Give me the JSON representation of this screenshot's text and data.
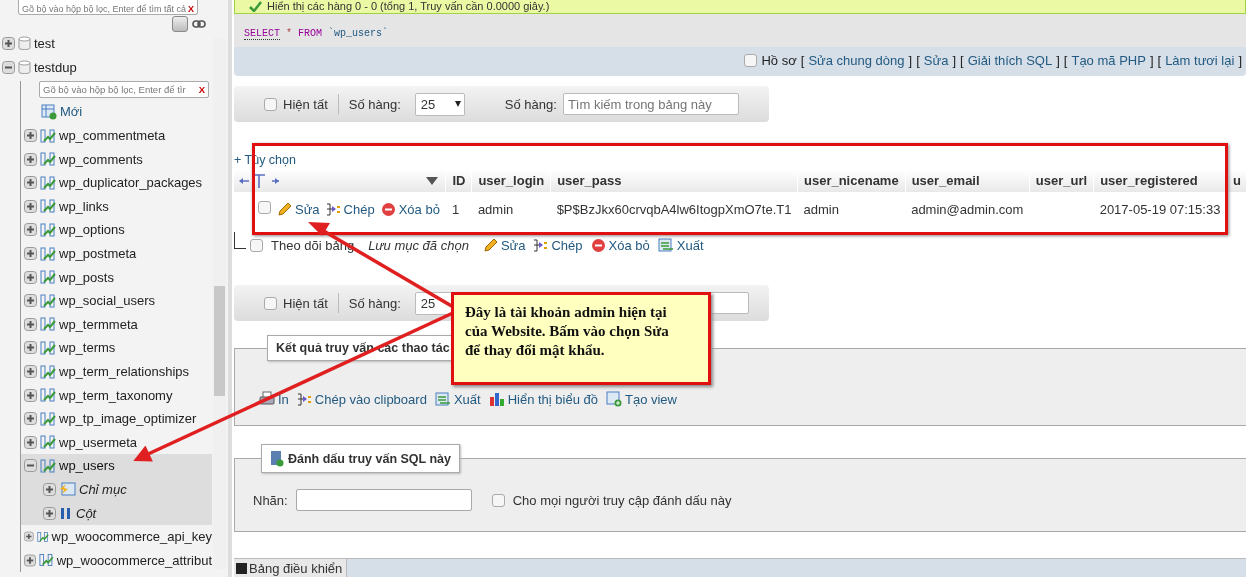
{
  "sidebar": {
    "filter_placeholder": "Gõ bộ vào hộp bộ lọc, Enter để tìm tất cả",
    "clear_label": "X",
    "databases": [
      {
        "name": "test",
        "expanded": false
      },
      {
        "name": "testdup",
        "expanded": true,
        "filter_placeholder": "Gõ bộ vào hộp bộ lọc, Enter để tìr",
        "clear_label": "X",
        "new_label": "Mới",
        "children": [
          {
            "name": "wp_commentmeta",
            "expanded": false,
            "selected": false
          },
          {
            "name": "wp_comments",
            "expanded": false,
            "selected": false
          },
          {
            "name": "wp_duplicator_packages",
            "expanded": false,
            "selected": false
          },
          {
            "name": "wp_links",
            "expanded": false,
            "selected": false
          },
          {
            "name": "wp_options",
            "expanded": false,
            "selected": false
          },
          {
            "name": "wp_postmeta",
            "expanded": false,
            "selected": false
          },
          {
            "name": "wp_posts",
            "expanded": false,
            "selected": false
          },
          {
            "name": "wp_social_users",
            "expanded": false,
            "selected": false
          },
          {
            "name": "wp_termmeta",
            "expanded": false,
            "selected": false
          },
          {
            "name": "wp_terms",
            "expanded": false,
            "selected": false
          },
          {
            "name": "wp_term_relationships",
            "expanded": false,
            "selected": false
          },
          {
            "name": "wp_term_taxonomy",
            "expanded": false,
            "selected": false
          },
          {
            "name": "wp_tp_image_optimizer",
            "expanded": false,
            "selected": false
          },
          {
            "name": "wp_usermeta",
            "expanded": false,
            "selected": false
          },
          {
            "name": "wp_users",
            "expanded": true,
            "selected": true,
            "children": [
              {
                "name": "Chỉ mục",
                "kind": "index"
              },
              {
                "name": "Cột",
                "kind": "columns"
              }
            ]
          },
          {
            "name": "wp_woocommerce_api_key",
            "expanded": false,
            "selected": false
          },
          {
            "name": "wp_woocommerce_attribut",
            "expanded": false,
            "selected": false
          }
        ]
      }
    ]
  },
  "message": "Hiển thị các hàng 0 - 0 (tổng 1, Truy vấn cần 0.0000 giây.)",
  "sql": {
    "keyword": "SELECT",
    "star": "*",
    "from": "FROM",
    "table": "`wp_users`"
  },
  "profile_bar": {
    "label": "Hồ sơ",
    "checked": false,
    "open": "[",
    "close": "]",
    "links": [
      "Sửa chung dòng",
      "Sửa",
      "Giải thích SQL",
      "Tạo mã PHP",
      "Làm tươi lại"
    ]
  },
  "toolbar": {
    "show_all": "Hiện tất",
    "show_all_checked": false,
    "rows_label": "Số hàng:",
    "rows_value": "25",
    "search_label": "Số hàng:",
    "search_placeholder": "Tìm kiếm trong bảng này"
  },
  "options_link": "+ Tùy chọn",
  "table": {
    "columns": [
      "ID",
      "user_login",
      "user_pass",
      "user_nicename",
      "user_email",
      "user_url",
      "user_registered",
      "u"
    ],
    "rows": [
      {
        "checked": false,
        "actions": [
          "Sửa",
          "Chép",
          "Xóa bỏ"
        ],
        "cells": [
          "1",
          "admin",
          "$P$BzJkx60crvqbA4lw6ItogpXmO7te.T1",
          "admin",
          "admin@admin.com",
          "",
          "2017-05-19 07:15:33",
          ""
        ]
      }
    ]
  },
  "bulk_actions": {
    "check_all": "Theo dõi bảng",
    "checked": false,
    "with_selected": "Lưu mục đã chọn",
    "actions": [
      "Sửa",
      "Chép",
      "Xóa bỏ",
      "Xuất"
    ]
  },
  "toolbar_bottom": {
    "show_all": "Hiện tất",
    "show_all_checked": false,
    "rows_label": "Số hàng:",
    "rows_value": "25"
  },
  "query_results": {
    "legend": "Kết quả truy vấn các thao tác",
    "links": [
      "In",
      "Chép vào clipboard",
      "Xuất",
      "Hiển thị biểu đồ",
      "Tạo view"
    ]
  },
  "bookmark": {
    "legend": "Đánh dấu truy vấn SQL này",
    "label": "Nhãn:",
    "share_label": "Cho mọi người truy cập đánh dấu này",
    "share_checked": false
  },
  "console": "Bảng điều khiển",
  "callout": "Đây là tài khoản admin hiện tại của Website. Bấm vào chọn Sửa để thay đổi mật khẩu."
}
